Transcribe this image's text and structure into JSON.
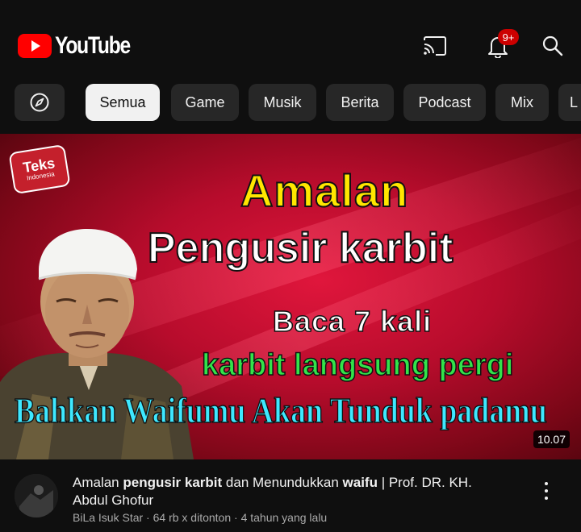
{
  "header": {
    "logo_text": "YouTube",
    "notification_count": "9+",
    "icons": [
      "cast-icon",
      "bell-icon",
      "search-icon"
    ]
  },
  "chips": {
    "explore_icon": "compass-icon",
    "items": [
      "Semua",
      "Game",
      "Musik",
      "Berita",
      "Podcast",
      "Mix",
      "L"
    ],
    "selected": "Semua"
  },
  "video": {
    "thumbnail": {
      "badge_main": "Teks",
      "badge_sub": "Indonesia",
      "line1": "Amalan",
      "line2": "Pengusir karbit",
      "line3": "Baca 7 kali",
      "line4": "karbit langsung pergi",
      "line5": "Bahkan Waifumu  Akan Tunduk padamu",
      "duration": "10.07"
    },
    "title_parts": {
      "p1": "Amalan ",
      "p2": "pengusir karbit",
      "p3": " dan Menundukkan ",
      "p4": "waifu",
      "p5": " | Prof. DR. KH. Abdul Ghofur"
    },
    "channel": "BiLa Isuk Star",
    "views": "64 rb x ditonton",
    "age": "4 tahun yang lalu"
  },
  "colors": {
    "background": "#0f0f0f",
    "chip": "#272727",
    "chip_active": "#f1f1f1",
    "brand_red": "#ff0000",
    "amalan_yellow": "#ffe600",
    "karbit_green": "#33e34a",
    "bahkan_cyan": "#3ee8ff"
  }
}
